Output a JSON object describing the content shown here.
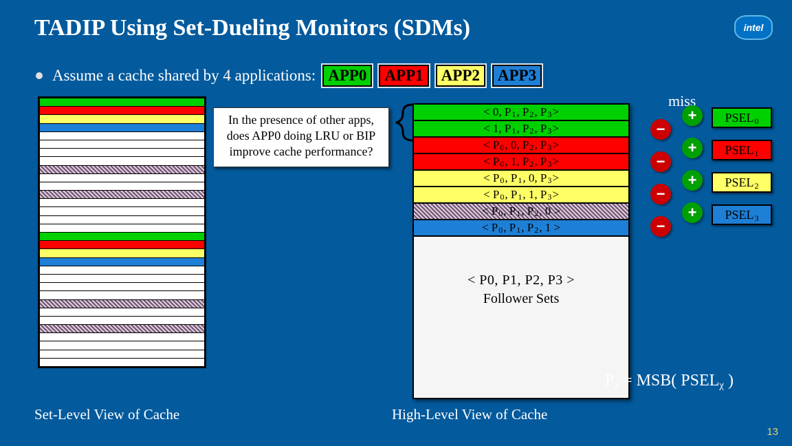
{
  "title": "TADIP Using Set-Dueling Monitors (SDMs)",
  "logo_text": "intel",
  "bullet": {
    "text": "Assume a cache shared by 4 applications:",
    "apps": [
      "APP0",
      "APP1",
      "APP2",
      "APP3"
    ]
  },
  "miss_label": "miss",
  "callout": "In the presence of other apps, does APP0 doing LRU or BIP improve cache performance?",
  "set_level": {
    "caption": "Set-Level View of Cache",
    "rows": [
      "green",
      "red",
      "yellow",
      "blue",
      "white",
      "white",
      "white",
      "white",
      "hatch",
      "white",
      "white",
      "hatch",
      "white",
      "white",
      "white",
      "white",
      "green",
      "red",
      "yellow",
      "blue",
      "white",
      "white",
      "white",
      "white",
      "hatch",
      "white",
      "white",
      "hatch",
      "white",
      "white",
      "white",
      "white"
    ]
  },
  "high_level": {
    "caption": "High-Level View of Cache",
    "rows": [
      {
        "color": "green",
        "text": "< 0, P1, P2, P3 >"
      },
      {
        "color": "green",
        "text": "< 1, P1, P2, P3 >"
      },
      {
        "color": "red",
        "text": "< P0, 0, P2, P3 >"
      },
      {
        "color": "red",
        "text": "< P0, 1, P2, P3 >"
      },
      {
        "color": "yellow",
        "text": "< P0, P1, 0, P3 >"
      },
      {
        "color": "yellow",
        "text": "< P0, P1, 1, P3 >"
      },
      {
        "color": "hatch",
        "text": "< P0, P1, P2, 0 >"
      },
      {
        "color": "blue",
        "text": "< P0, P1, P2, 1 >"
      }
    ],
    "follower_line1": "< P0, P1, P2, P3 >",
    "follower_line2": "Follower Sets"
  },
  "pm": {
    "plus": "+",
    "minus": "−"
  },
  "psel": [
    "PSEL0",
    "PSEL1",
    "PSEL2",
    "PSEL3"
  ],
  "psel_colors": [
    "app0",
    "app1",
    "app2",
    "app3"
  ],
  "equation": "Pχ = MSB( PSELχ )",
  "page_number": "13"
}
